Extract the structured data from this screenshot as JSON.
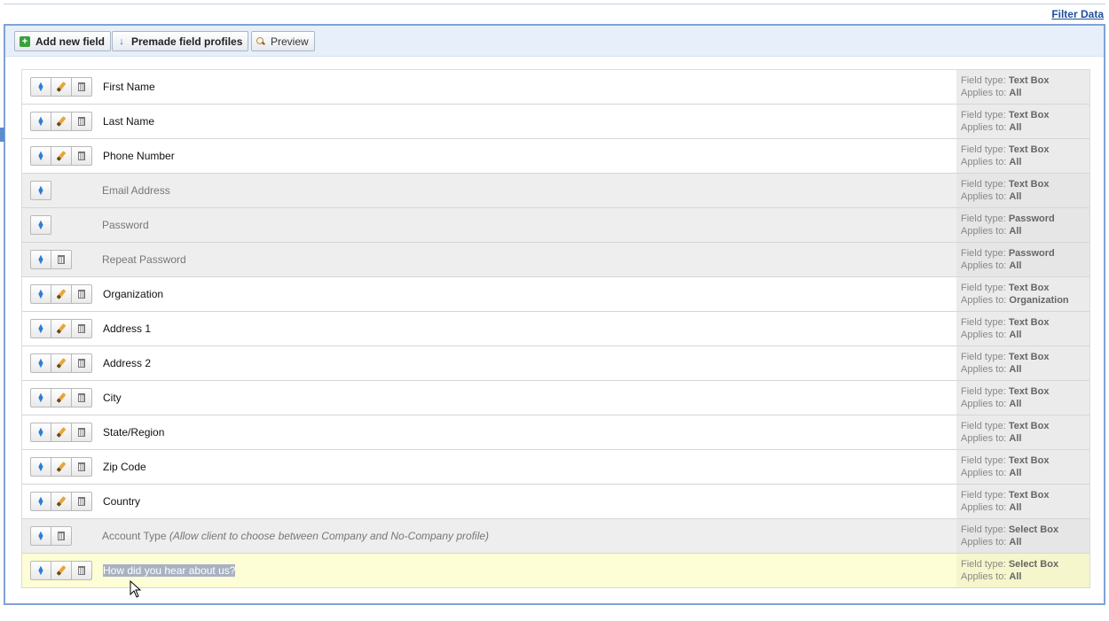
{
  "header": {
    "filter_link": "Filter Data"
  },
  "toolbar": {
    "add_label": "Add new field",
    "premade_label": "Premade field profiles",
    "preview_label": "Preview"
  },
  "meta_labels": {
    "type": "Field type: ",
    "applies": "Applies to: "
  },
  "fields": [
    {
      "name": "First Name",
      "type": "Text Box",
      "applies": "All"
    },
    {
      "name": "Last Name",
      "type": "Text Box",
      "applies": "All"
    },
    {
      "name": "Phone Number",
      "type": "Text Box",
      "applies": "All"
    },
    {
      "name": "Email Address",
      "type": "Text Box",
      "applies": "All"
    },
    {
      "name": "Password",
      "type": "Password",
      "applies": "All"
    },
    {
      "name": "Repeat Password",
      "type": "Password",
      "applies": "All"
    },
    {
      "name": "Organization",
      "type": "Text Box",
      "applies": "Organization"
    },
    {
      "name": "Address 1",
      "type": "Text Box",
      "applies": "All"
    },
    {
      "name": "Address 2",
      "type": "Text Box",
      "applies": "All"
    },
    {
      "name": "City",
      "type": "Text Box",
      "applies": "All"
    },
    {
      "name": "State/Region",
      "type": "Text Box",
      "applies": "All"
    },
    {
      "name": "Zip Code",
      "type": "Text Box",
      "applies": "All"
    },
    {
      "name": "Country",
      "type": "Text Box",
      "applies": "All"
    },
    {
      "name": "Account Type",
      "note": "(Allow client to choose between Company and No-Company profile)",
      "type": "Select Box",
      "applies": "All"
    },
    {
      "name": "How did you hear about us?",
      "type": "Select Box",
      "applies": "All"
    }
  ]
}
